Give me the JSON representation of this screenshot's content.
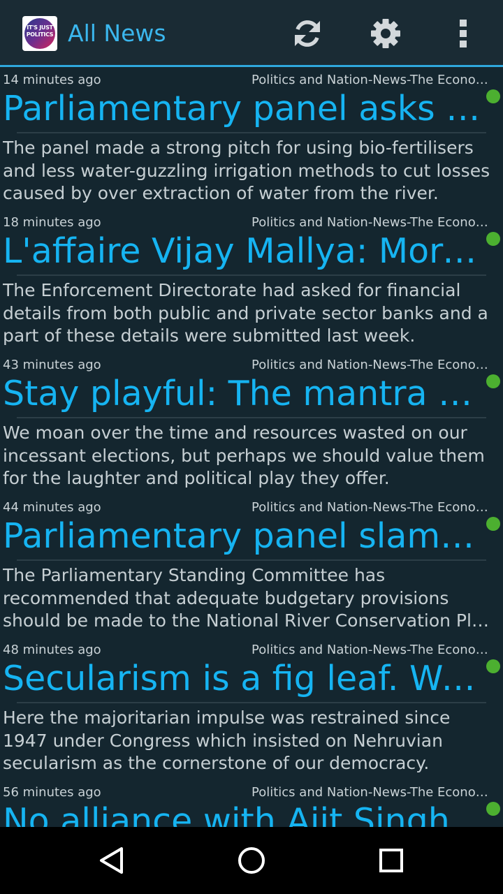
{
  "app": {
    "title": "All News",
    "logo_text_line1": "IT'S JUST",
    "logo_text_line2": "POLITICS"
  },
  "toolbar": {
    "refresh_icon": "refresh-icon",
    "settings_icon": "gear-icon",
    "overflow_icon": "more-vert-icon"
  },
  "colors": {
    "accent": "#16b4f2",
    "unread": "#4caf30",
    "background": "#14262f"
  },
  "articles": [
    {
      "time": "14 minutes ago",
      "source": "Politics and Nation-News-The Economic Times",
      "title": "Parliamentary panel asks govt to promote bio-fertilisers",
      "summary": "The panel made a strong pitch for using bio-fertilisers and less water-guzzling irrigation methods to cut losses caused by over extraction of water from the river."
    },
    {
      "time": "18 minutes ago",
      "source": "Politics and Nation-News-The Economic Times",
      "title": "L'affaire Vijay Mallya: More banks submit details",
      "summary": "The Enforcement Directorate had asked for financial details from both public and private sector banks and a part of these details were submitted last week."
    },
    {
      "time": "43 minutes ago",
      "source": "Politics and Nation-News-The Economic Times",
      "title": "Stay playful: The mantra you need this election season",
      "summary": "We moan over the time and resources wasted on our incessant elections, but perhaps we should value them for the laughter and political play they offer."
    },
    {
      "time": "44 minutes ago",
      "source": "Politics and Nation-News-The Economic Times",
      "title": "Parliamentary panel slams govt over river conservation",
      "summary": "The Parliamentary Standing Committee has recommended that adequate budgetary provisions should be made to the National River Conservation Plan for better results."
    },
    {
      "time": "48 minutes ago",
      "source": "Politics and Nation-News-The Economic Times",
      "title": "Secularism is a fig leaf. We’re a majoritarian democracy",
      "summary": "Here the majoritarian impulse was restrained since 1947 under Congress which insisted on Nehruvian secularism as the cornerstone of our democracy."
    },
    {
      "time": "56 minutes ago",
      "source": "Politics and Nation-News-The Economic Times",
      "title": "No alliance with Ajit Singh's RLD",
      "summary": ""
    }
  ],
  "navbar": {
    "back_icon": "back-triangle-icon",
    "home_icon": "home-circle-icon",
    "recents_icon": "recents-square-icon"
  }
}
